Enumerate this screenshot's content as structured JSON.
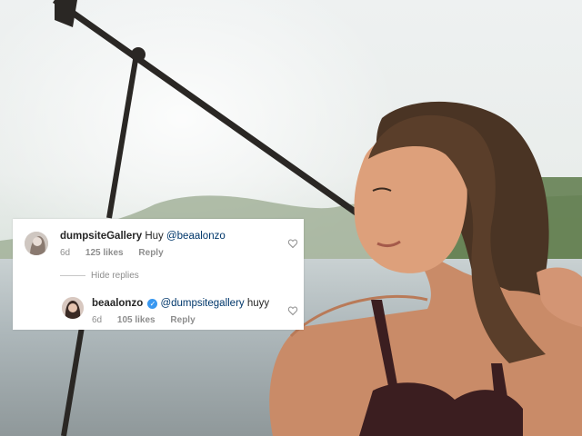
{
  "comments": [
    {
      "username": "dumpsiteGallery",
      "text": "Huy ",
      "mention": "@beaalonzo",
      "age": "6d",
      "likes": "125 likes",
      "reply_label": "Reply"
    }
  ],
  "replies_toggle": "Hide replies",
  "replies": [
    {
      "username": "beaalonzo",
      "verified": true,
      "mention": "@dumpsitegallery",
      "text": " huyy",
      "age": "6d",
      "likes": "105 likes",
      "reply_label": "Reply"
    }
  ],
  "colors": {
    "mention": "#00376b",
    "meta": "#8e8e8e",
    "verified_badge": "#3897f0"
  }
}
